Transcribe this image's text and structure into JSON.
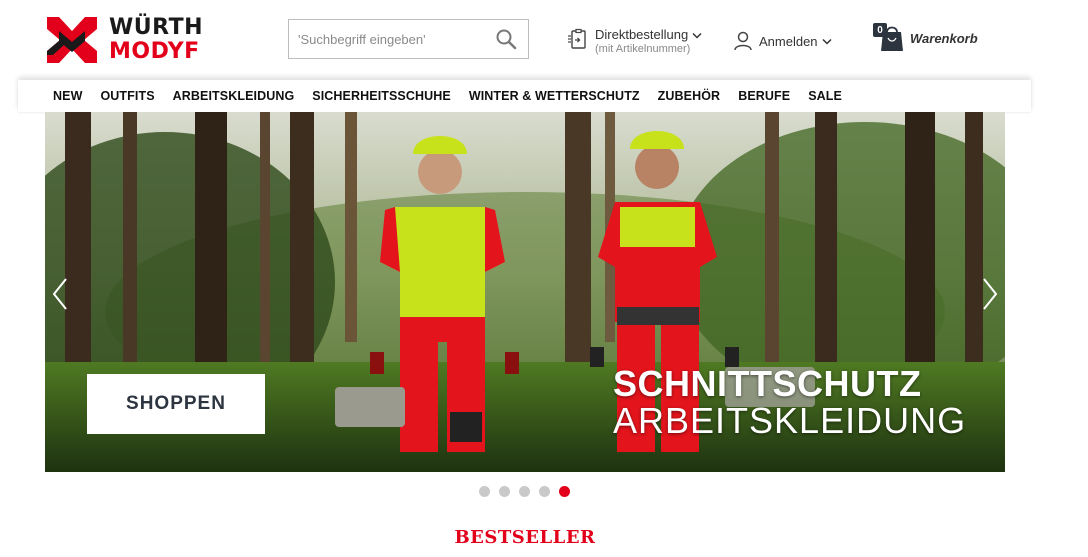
{
  "brand": {
    "line1": "WÜRTH",
    "line2": "MODYF",
    "color_primary": "#e2001a",
    "color_dark": "#1a1a1a"
  },
  "search": {
    "placeholder": "'Suchbegriff eingeben'",
    "icon": "search-icon"
  },
  "direktbestellung": {
    "label": "Direktbestellung",
    "sublabel": "(mit Artikelnummer)",
    "icon": "clipboard-icon"
  },
  "account": {
    "label": "Anmelden",
    "icon": "user-icon"
  },
  "cart": {
    "count": "0",
    "label": "Warenkorb",
    "icon": "shopping-bag-icon"
  },
  "nav": {
    "items": [
      "NEW",
      "OUTFITS",
      "ARBEITSKLEIDUNG",
      "SICHERHEITSSCHUHE",
      "WINTER & WETTERSCHUTZ",
      "ZUBEHÖR",
      "BERUFE",
      "SALE"
    ]
  },
  "hero": {
    "button_label": "SHOPPEN",
    "title_line1": "SCHNITTSCHUTZ",
    "title_line2": "ARBEITSKLEIDUNG",
    "slide_count": 5,
    "active_slide": 5
  },
  "section": {
    "bestseller": "BESTSELLER"
  }
}
